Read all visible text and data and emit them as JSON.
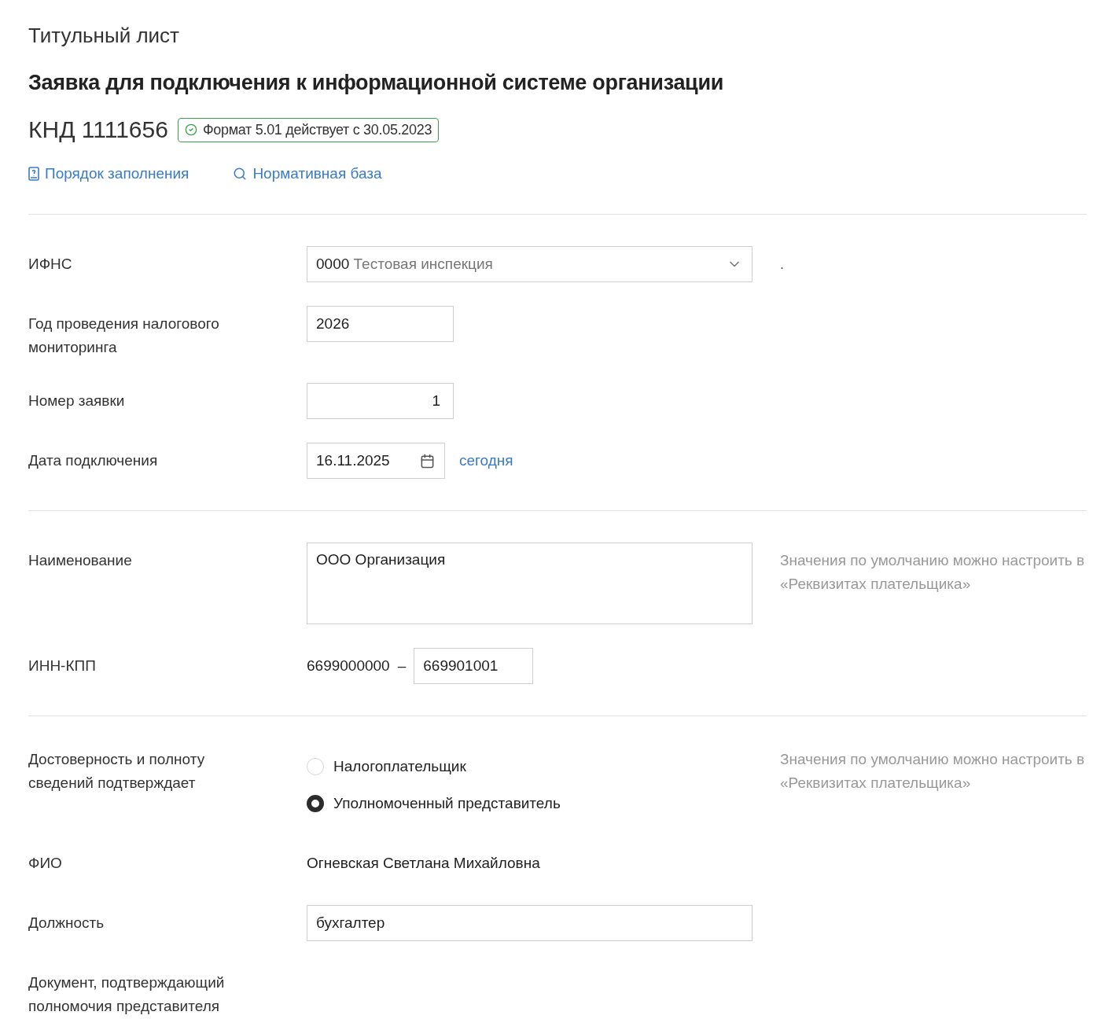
{
  "header": {
    "subtitle": "Титульный лист",
    "title": "Заявка для подключения к информационной системе организации",
    "knd": "КНД 1111656",
    "format_badge": "Формат 5.01 действует с 30.05.2023"
  },
  "links": [
    {
      "kind": "book",
      "label": "Порядок заполнения"
    },
    {
      "kind": "search",
      "label": "Нормативная база"
    }
  ],
  "sections": [
    {
      "rows": [
        {
          "kind": "select",
          "label": "ИФНС",
          "code": "0000",
          "value": "Тестовая инспекция",
          "note": "."
        },
        {
          "kind": "text",
          "label": "Год проведения налогового мониторинга",
          "value": "2026"
        },
        {
          "kind": "number",
          "label": "Номер заявки",
          "value": "1"
        },
        {
          "kind": "date",
          "label": "Дата подключения",
          "value": "16.11.2025",
          "link": "сегодня"
        }
      ]
    },
    {
      "hint": "Значения по умолчанию можно настроить в «Реквизитах плательщика»",
      "rows": [
        {
          "kind": "textarea",
          "label": "Наименование",
          "value": "ООО Организация"
        },
        {
          "kind": "inn_kpp",
          "label": "ИНН-КПП",
          "inn": "6699000000",
          "dash": "–",
          "kpp": "669901001"
        }
      ]
    },
    {
      "hint": "Значения по умолчанию можно настроить в «Реквизитах плательщика»",
      "rows": [
        {
          "kind": "radio",
          "label": "Достоверность и полноту сведений подтверждает",
          "options": [
            {
              "label": "Налогоплательщик",
              "selected": false
            },
            {
              "label": "Уполномоченный представитель",
              "selected": true
            }
          ]
        },
        {
          "kind": "static",
          "label": "ФИО",
          "value": "Огневская Светлана Михайловна"
        },
        {
          "kind": "wide_text",
          "label": "Должность",
          "value": "бухгалтер"
        },
        {
          "kind": "none",
          "label": "Документ, подтверждающий полномочия представителя"
        }
      ]
    }
  ]
}
